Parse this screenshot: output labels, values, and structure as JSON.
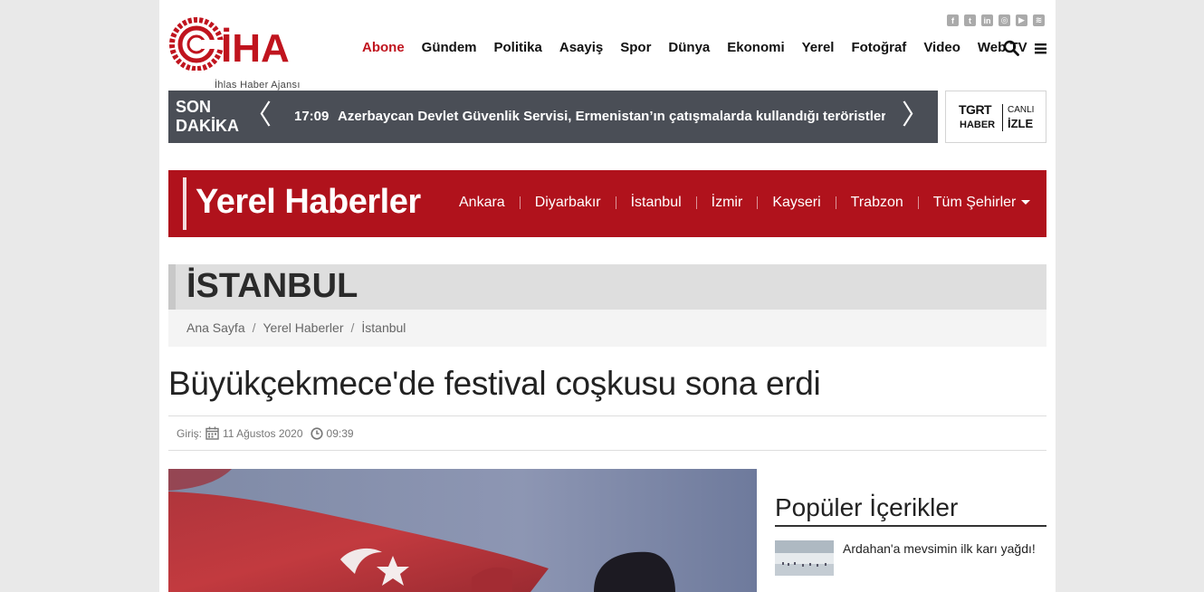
{
  "header": {
    "logo_text": "İHA",
    "logo_subtitle": "İhlas Haber Ajansı",
    "nav": [
      {
        "label": "Abone",
        "active": true
      },
      {
        "label": "Gündem"
      },
      {
        "label": "Politika"
      },
      {
        "label": "Asayiş"
      },
      {
        "label": "Spor"
      },
      {
        "label": "Dünya"
      },
      {
        "label": "Ekonomi"
      },
      {
        "label": "Yerel"
      },
      {
        "label": "Fotoğraf"
      },
      {
        "label": "Video"
      },
      {
        "label": "Web TV"
      }
    ],
    "social_icons": [
      "facebook-icon",
      "twitter-icon",
      "linkedin-icon",
      "instagram-icon",
      "youtube-icon",
      "rss-icon"
    ]
  },
  "ticker": {
    "label_line1": "SON",
    "label_line2": "DAKİKA",
    "time": "17:09",
    "text": "Azerbaycan Devlet Güvenlik Servisi, Ermenistan’ın çatışmalarda kullandığı teröristlerin ses"
  },
  "live_tv": {
    "brand_top": "TGRT",
    "brand_bottom": "HABER",
    "canli": "CANLI",
    "izle": "İZLE"
  },
  "local": {
    "title": "Yerel Haberler",
    "cities": [
      "Ankara",
      "Diyarbakır",
      "İstanbul",
      "İzmir",
      "Kayseri",
      "Trabzon"
    ],
    "all_cities": "Tüm Şehirler"
  },
  "section": {
    "title": "İSTANBUL",
    "breadcrumbs": [
      "Ana Sayfa",
      "Yerel Haberler",
      "İstanbul"
    ]
  },
  "article": {
    "headline": "Büyükçekmece'de festival coşkusu sona erdi",
    "entry_label": "Giriş:",
    "date": "11 Ağustos 2020",
    "time": "09:39"
  },
  "sidebar": {
    "popular_title": "Popüler İçerikler",
    "items": [
      {
        "title": "Ardahan'a mevsimin ilk karı yağdı!"
      }
    ]
  },
  "colors": {
    "brand_red": "#c0141e",
    "local_bar": "#b0121c",
    "ticker_bg": "#4a4e56"
  }
}
